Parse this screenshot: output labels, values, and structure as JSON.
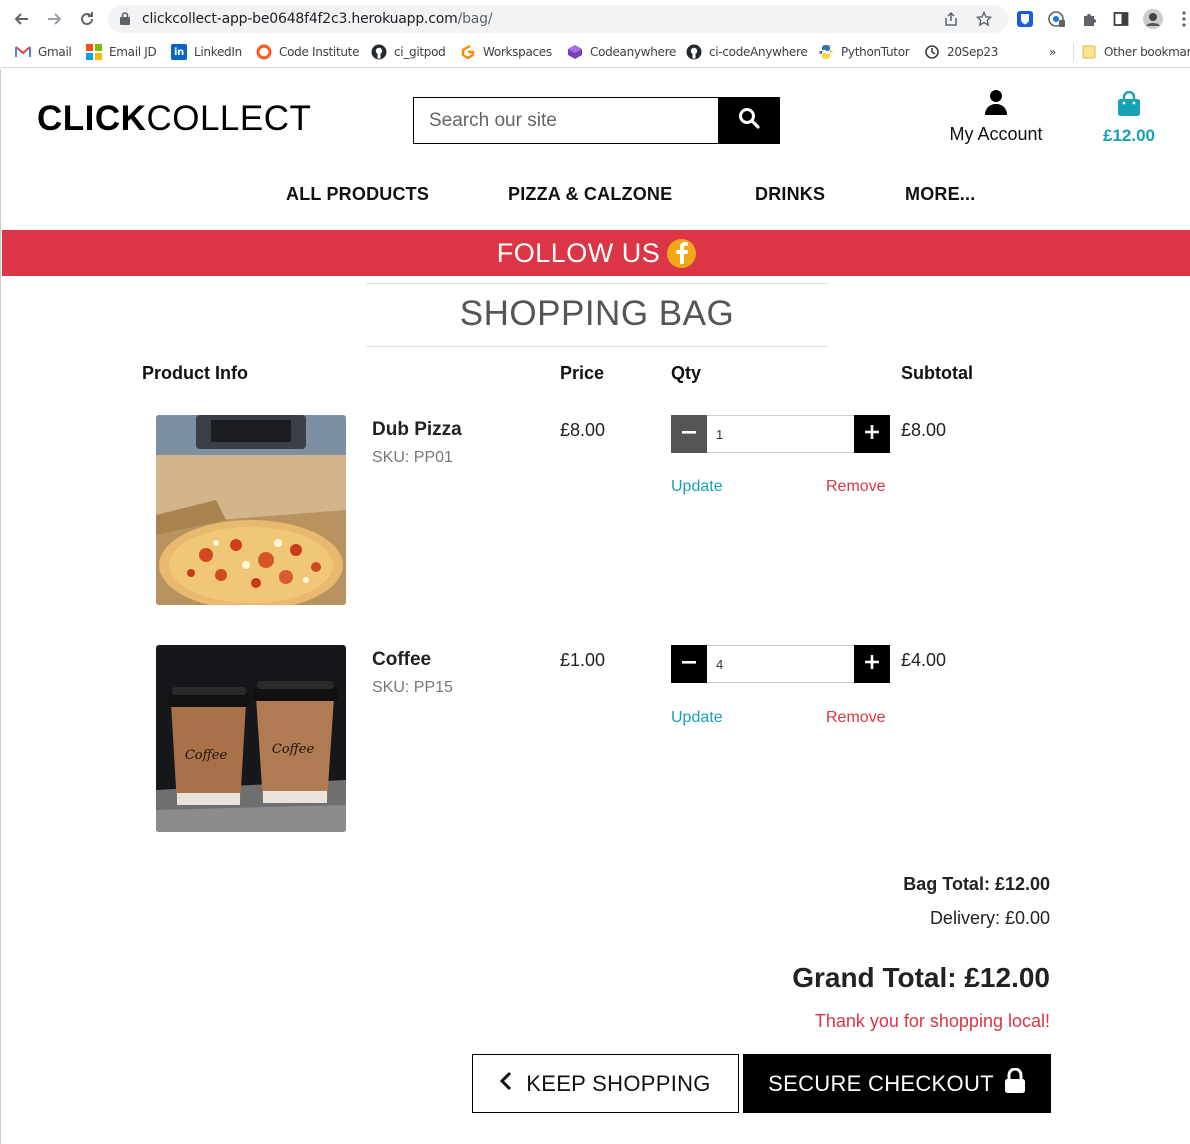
{
  "browser": {
    "url_host": "clickcollect-app-be0648f4f2c3.herokuapp.com",
    "url_path": "/bag/",
    "bookmarks": [
      {
        "label": "Gmail",
        "icon": "gmail-icon"
      },
      {
        "label": "Email JD",
        "icon": "microsoft-icon"
      },
      {
        "label": "LinkedIn",
        "icon": "linkedin-icon"
      },
      {
        "label": "Code Institute",
        "icon": "code-institute-icon"
      },
      {
        "label": "ci_gitpod",
        "icon": "github-icon"
      },
      {
        "label": "Workspaces",
        "icon": "gitpod-icon"
      },
      {
        "label": "Codeanywhere",
        "icon": "codeanywhere-icon"
      },
      {
        "label": "ci-codeAnywhere",
        "icon": "github-icon"
      },
      {
        "label": "PythonTutor",
        "icon": "python-icon"
      },
      {
        "label": "20Sep23",
        "icon": "history-icon"
      }
    ],
    "overflow_label": "»",
    "other_bookmarks": "Other bookmarks"
  },
  "header": {
    "logo_bold": "CLICK",
    "logo_rest": "COLLECT",
    "search_placeholder": "Search our site",
    "account_label": "My Account",
    "bag_total": "£12.00"
  },
  "nav": {
    "items": [
      "ALL PRODUCTS",
      "PIZZA & CALZONE",
      "DRINKS",
      "MORE..."
    ]
  },
  "banner": {
    "text": "FOLLOW US"
  },
  "bag": {
    "title": "SHOPPING BAG",
    "columns": {
      "product": "Product Info",
      "price": "Price",
      "qty": "Qty",
      "subtotal": "Subtotal"
    },
    "items": [
      {
        "name": "Dub Pizza",
        "sku": "SKU: PP01",
        "price": "£8.00",
        "qty": "1",
        "subtotal": "£8.00",
        "update": "Update",
        "remove": "Remove"
      },
      {
        "name": "Coffee",
        "sku": "SKU: PP15",
        "price": "£1.00",
        "qty": "4",
        "subtotal": "£4.00",
        "update": "Update",
        "remove": "Remove"
      }
    ],
    "cup_text": "Coffee",
    "bag_total": "Bag Total: £12.00",
    "delivery": "Delivery: £0.00",
    "grand_total": "Grand Total: £12.00",
    "thanks": "Thank you for shopping local!",
    "keep_shopping": "KEEP SHOPPING",
    "secure_checkout": "SECURE CHECKOUT"
  },
  "colors": {
    "accent_teal": "#17a2b8",
    "danger_red": "#dc3545"
  }
}
